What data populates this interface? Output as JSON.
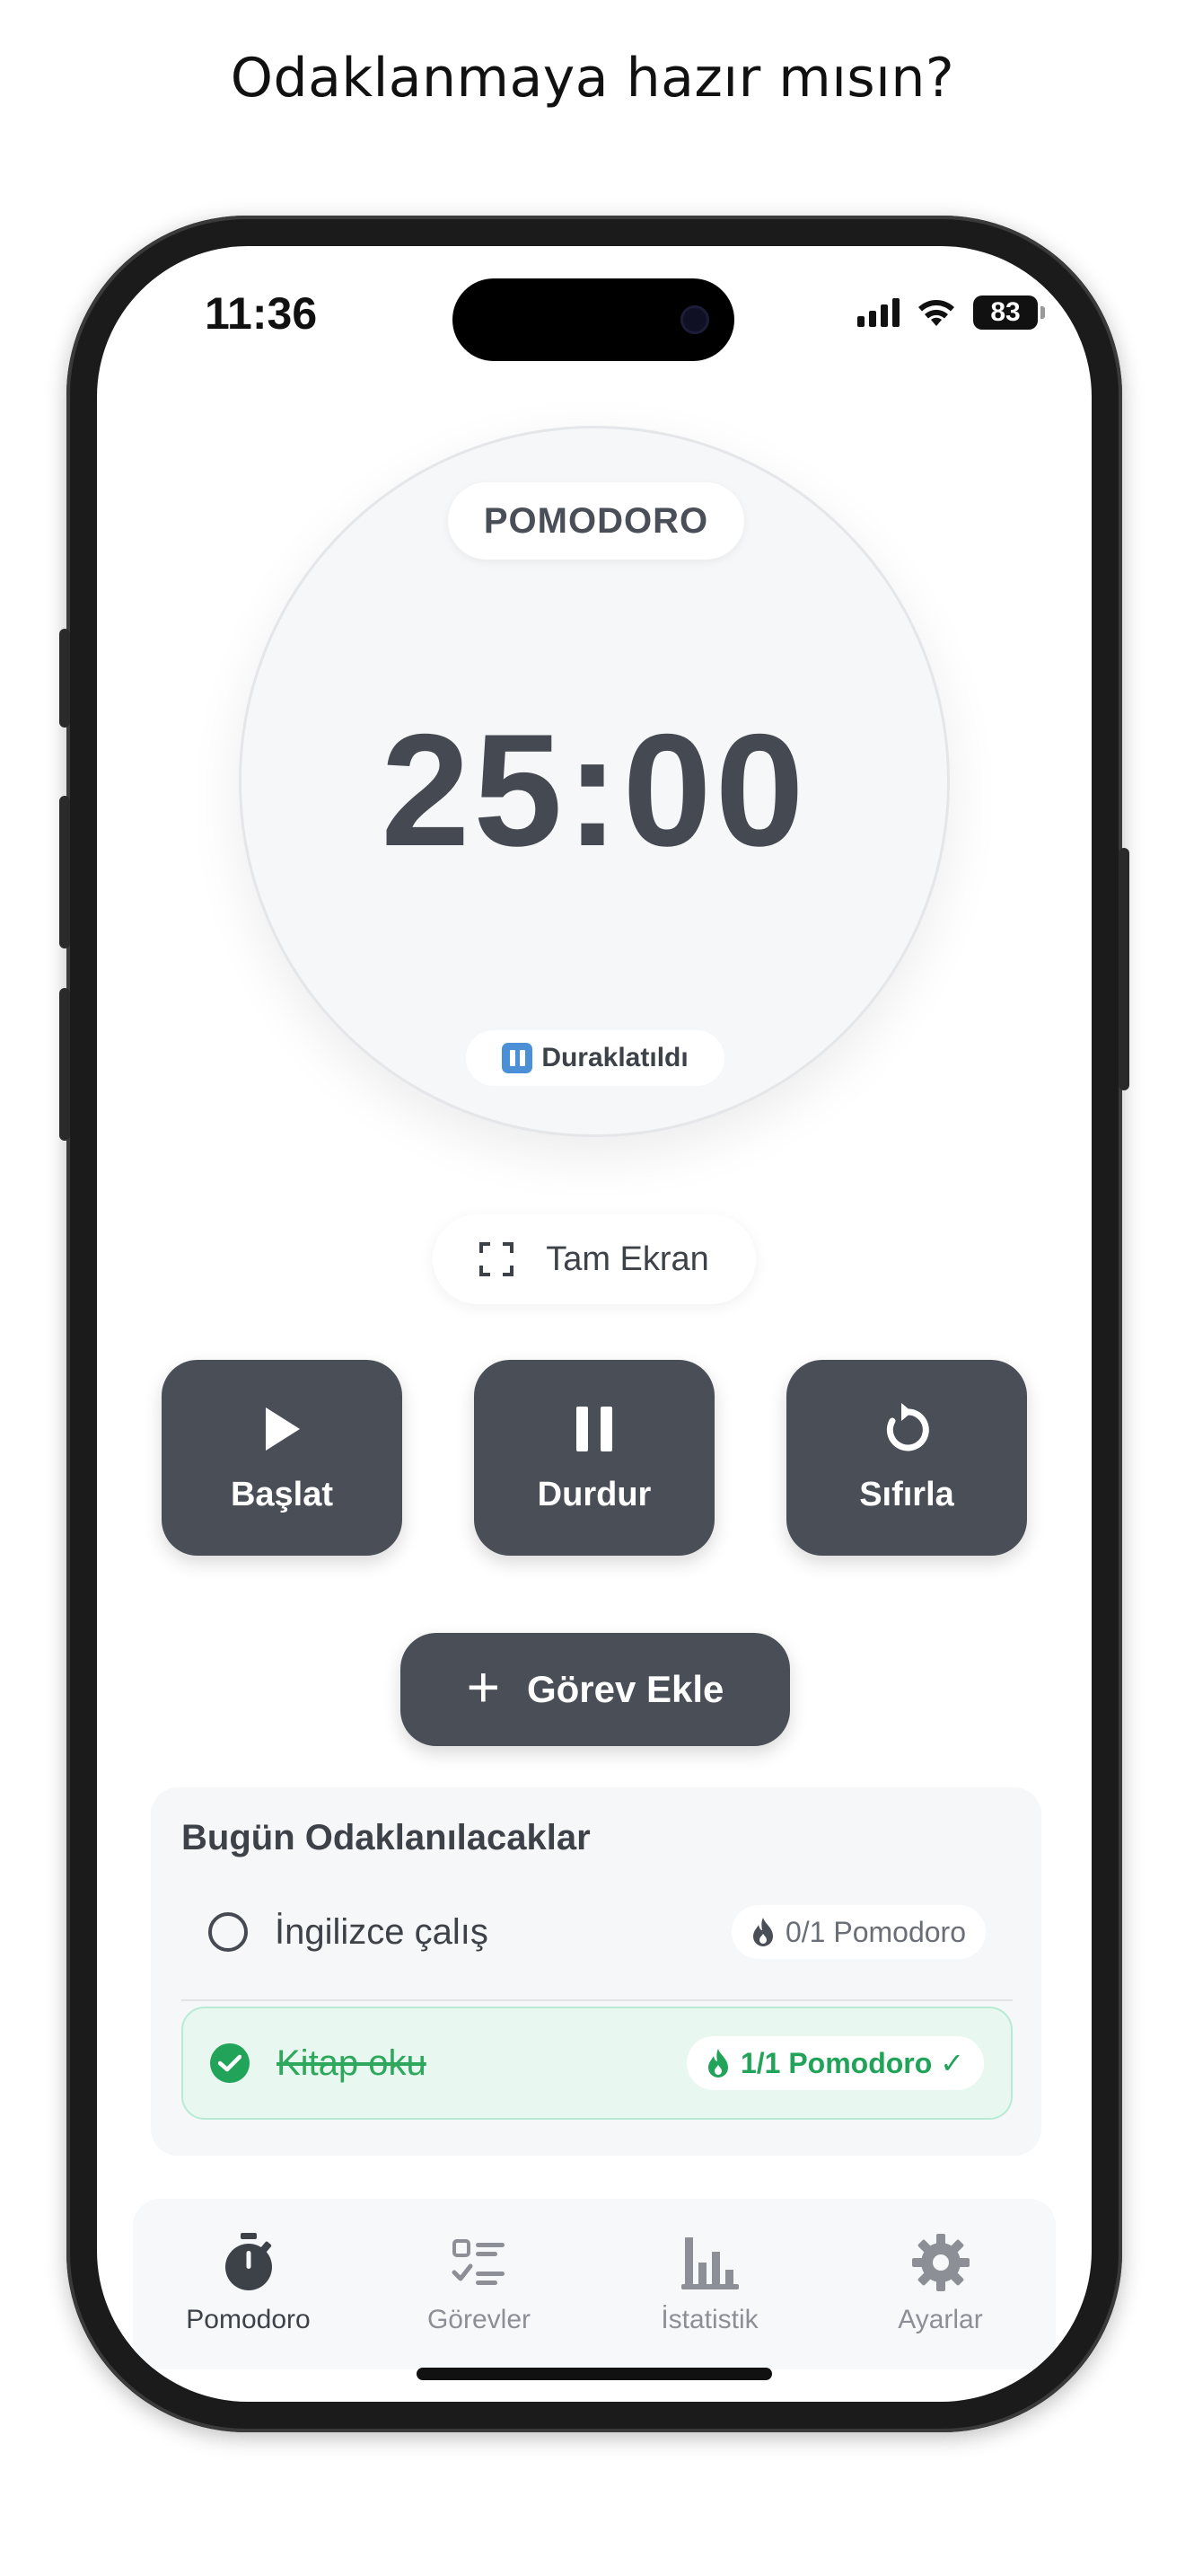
{
  "headline": "Odaklanmaya hazır mısın?",
  "status_bar": {
    "time": "11:36",
    "battery": "83"
  },
  "timer": {
    "mode": "POMODORO",
    "value": "25:00",
    "state": "Duraklatıldı",
    "state_icon": "pause-button-icon"
  },
  "fullscreen": {
    "label": "Tam Ekran",
    "icon": "fullscreen-icon"
  },
  "controls": [
    {
      "label": "Başlat",
      "icon": "play-icon"
    },
    {
      "label": "Durdur",
      "icon": "pause-icon"
    },
    {
      "label": "Sıfırla",
      "icon": "reset-icon"
    }
  ],
  "add_task": {
    "label": "Görev Ekle",
    "icon": "plus-icon"
  },
  "today": {
    "title": "Bugün Odaklanılacaklar",
    "tasks": [
      {
        "label": "İngilizce çalış",
        "done": false,
        "pomodoro": "0/1 Pomodoro",
        "icon": "flame-icon"
      },
      {
        "label": "Kitap oku",
        "done": true,
        "pomodoro": "1/1 Pomodoro ✓",
        "icon": "flame-icon"
      }
    ]
  },
  "tabs": [
    {
      "label": "Pomodoro",
      "icon": "stopwatch-icon",
      "active": true
    },
    {
      "label": "Görevler",
      "icon": "checklist-icon",
      "active": false
    },
    {
      "label": "İstatistik",
      "icon": "bar-chart-icon",
      "active": false
    },
    {
      "label": "Ayarlar",
      "icon": "gear-icon",
      "active": false
    }
  ],
  "colors": {
    "button_dark": "#4a4f57",
    "success_green": "#22a35a",
    "done_row_bg": "#e8f8f1",
    "pause_badge_blue": "#4b8fd6"
  }
}
